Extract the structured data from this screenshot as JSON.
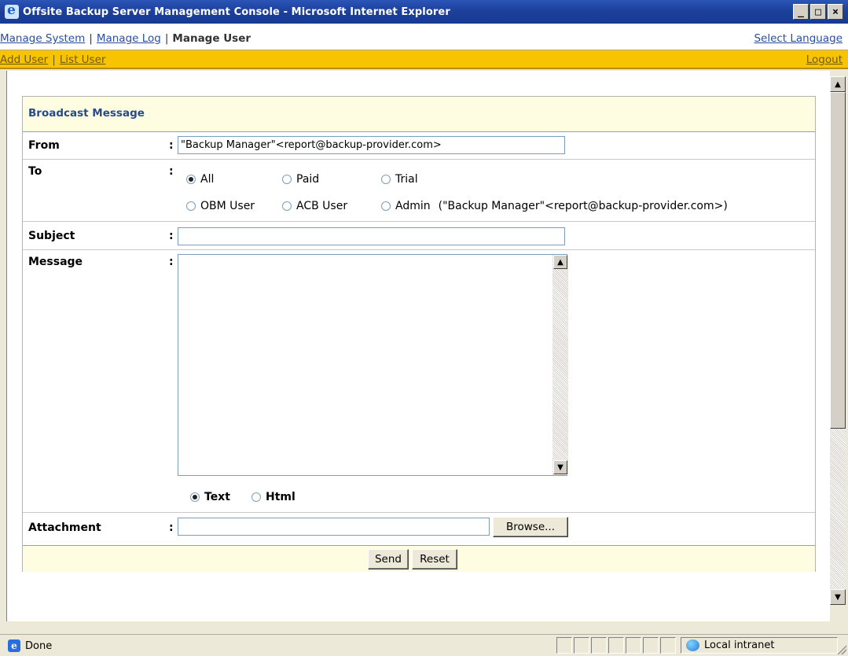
{
  "window": {
    "title": "Offsite Backup Server Management Console - Microsoft Internet Explorer",
    "min_label": "_",
    "max_label": "□",
    "close_label": "×"
  },
  "nav_main": {
    "items": [
      "Manage System",
      "Manage Log",
      "Manage User"
    ],
    "separator": "|",
    "select_language": "Select Language"
  },
  "nav_sub": {
    "items": [
      "Add User",
      "List User"
    ],
    "separator": "|",
    "logout": "Logout"
  },
  "form": {
    "header": "Broadcast Message",
    "colon": ":",
    "from_label": "From",
    "from_value": "\"Backup Manager\"<report@backup-provider.com>",
    "to_label": "To",
    "to_options": [
      {
        "label": "All",
        "checked": true
      },
      {
        "label": "Paid",
        "checked": false
      },
      {
        "label": "Trial",
        "checked": false
      },
      {
        "label": "OBM User",
        "checked": false
      },
      {
        "label": "ACB User",
        "checked": false
      },
      {
        "label": "Admin",
        "checked": false
      }
    ],
    "admin_address": "(\"Backup Manager\"<report@backup-provider.com>)",
    "subject_label": "Subject",
    "subject_value": "",
    "message_label": "Message",
    "message_value": "",
    "format_options": [
      {
        "label": "Text",
        "checked": true
      },
      {
        "label": "Html",
        "checked": false
      }
    ],
    "attachment_label": "Attachment",
    "attachment_value": "",
    "browse_label": "Browse...",
    "send_label": "Send",
    "reset_label": "Reset"
  },
  "statusbar": {
    "status": "Done",
    "zone": "Local intranet"
  }
}
